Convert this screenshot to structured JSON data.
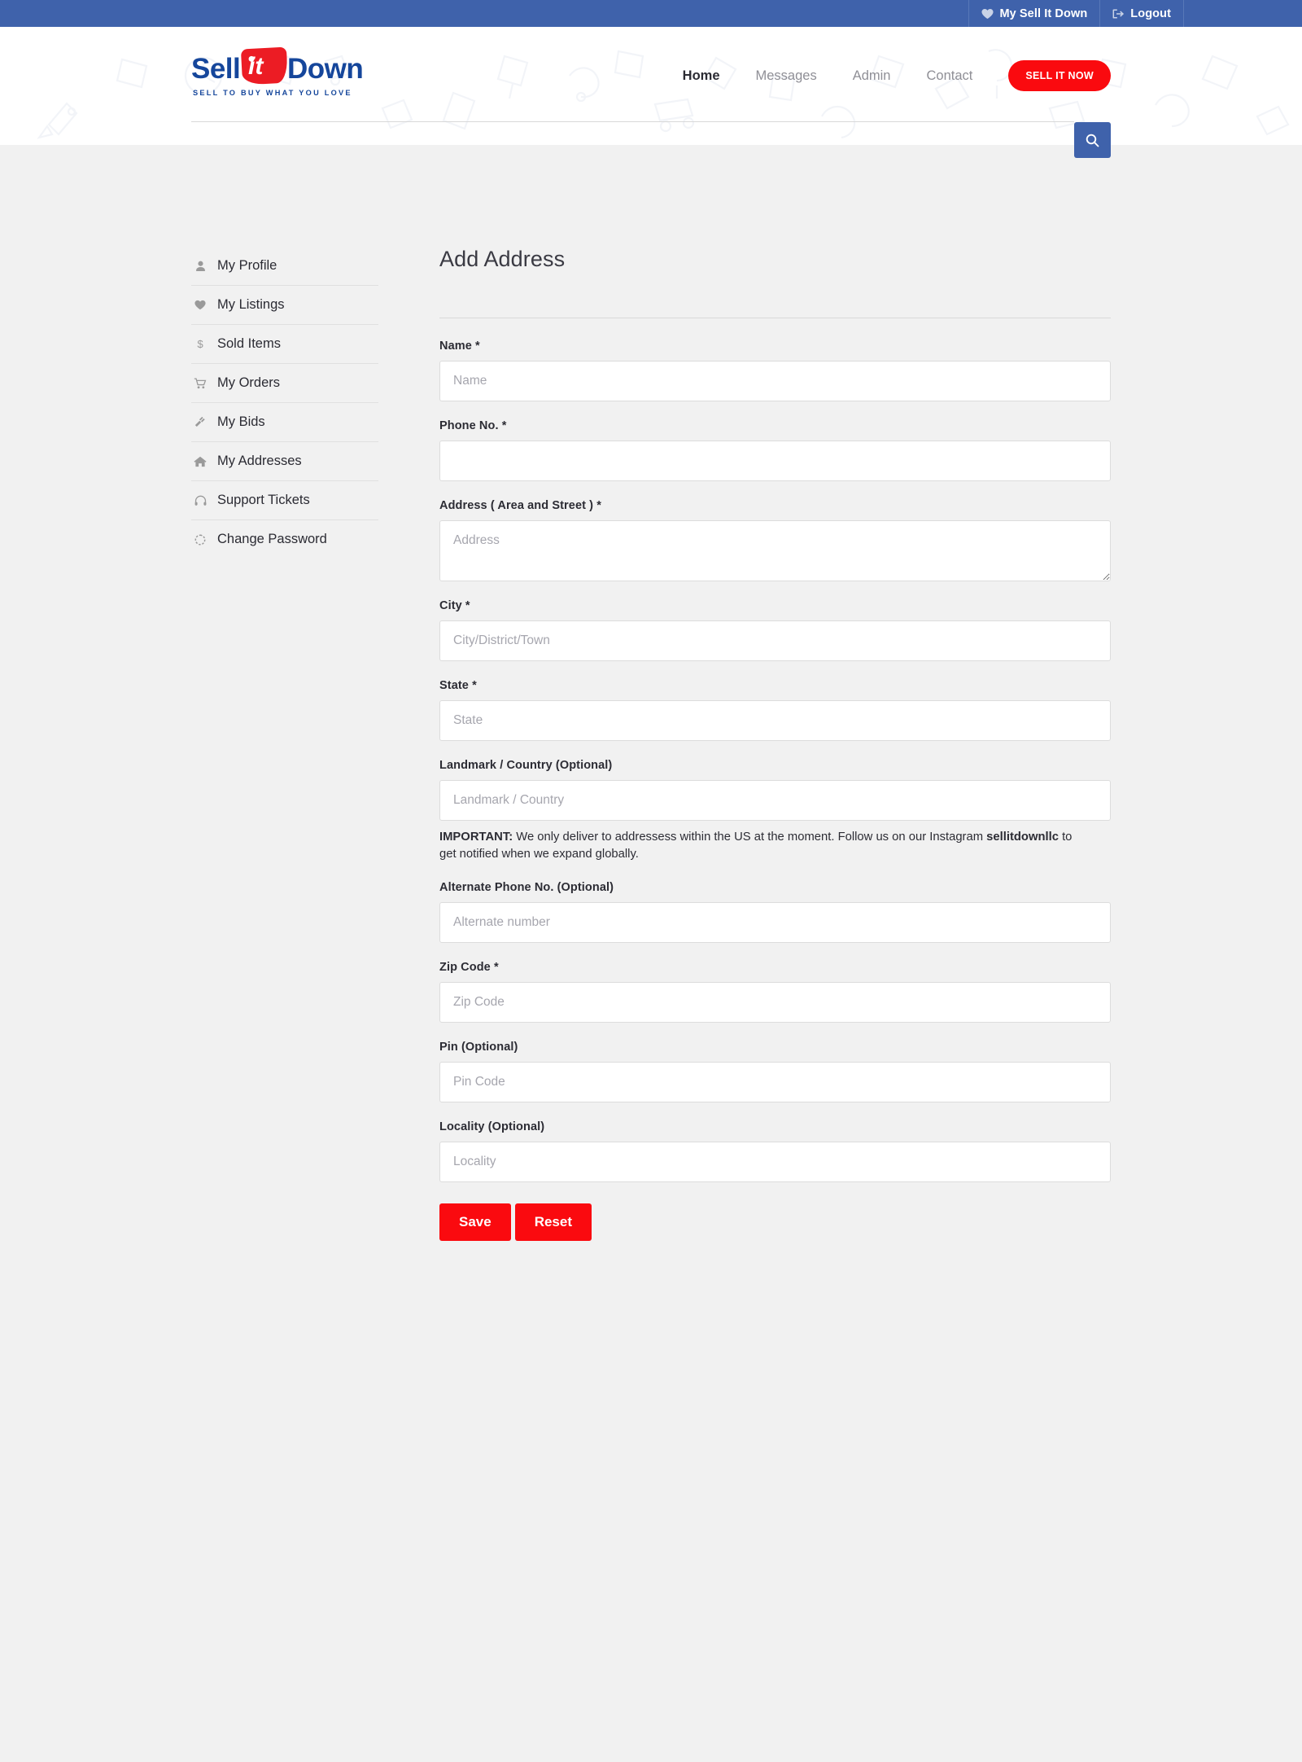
{
  "topbar": {
    "items": [
      {
        "label": "My Sell It Down",
        "icon": "heart-icon"
      },
      {
        "label": "Logout",
        "icon": "logout-icon"
      }
    ]
  },
  "brand": {
    "word1": "Sell",
    "badge": "it",
    "word2": "Down",
    "tagline": "SELL TO BUY WHAT YOU LOVE"
  },
  "nav": {
    "links": [
      {
        "label": "Home",
        "active": true
      },
      {
        "label": "Messages",
        "active": false
      },
      {
        "label": "Admin",
        "active": false
      },
      {
        "label": "Contact",
        "active": false
      }
    ],
    "cta": "SELL IT NOW"
  },
  "search": {
    "value": "",
    "placeholder": "",
    "icon": "search-icon"
  },
  "sidebar": {
    "items": [
      {
        "label": "My Profile",
        "icon": "user-icon"
      },
      {
        "label": "My Listings",
        "icon": "heart-icon"
      },
      {
        "label": "Sold Items",
        "icon": "dollar-icon"
      },
      {
        "label": "My Orders",
        "icon": "cart-icon"
      },
      {
        "label": "My Bids",
        "icon": "gavel-icon"
      },
      {
        "label": "My Addresses",
        "icon": "home-icon"
      },
      {
        "label": "Support Tickets",
        "icon": "headset-icon"
      },
      {
        "label": "Change Password",
        "icon": "refresh-icon"
      }
    ]
  },
  "form": {
    "title": "Add Address",
    "fields": [
      {
        "label": "Name *",
        "placeholder": "Name",
        "value": "",
        "type": "text"
      },
      {
        "label": "Phone No. *",
        "placeholder": "",
        "value": "",
        "type": "text"
      },
      {
        "label": "Address ( Area and Street ) *",
        "placeholder": "Address",
        "value": "",
        "type": "textarea"
      },
      {
        "label": "City *",
        "placeholder": "City/District/Town",
        "value": "",
        "type": "text"
      },
      {
        "label": "State *",
        "placeholder": "State",
        "value": "",
        "type": "text"
      },
      {
        "label": "Landmark / Country (Optional)",
        "placeholder": "Landmark / Country",
        "value": "",
        "type": "text"
      },
      {
        "label": "Alternate Phone No. (Optional)",
        "placeholder": "Alternate number",
        "value": "",
        "type": "text"
      },
      {
        "label": "Zip Code *",
        "placeholder": "Zip Code",
        "value": "",
        "type": "text"
      },
      {
        "label": "Pin (Optional)",
        "placeholder": "Pin Code",
        "value": "",
        "type": "text"
      },
      {
        "label": "Locality (Optional)",
        "placeholder": "Locality",
        "value": "",
        "type": "text"
      }
    ],
    "note": {
      "lead": "IMPORTANT:",
      "text_before": " We only deliver to addressess within the US at the moment. Follow us on our Instagram ",
      "handle": "sellitdownllc",
      "text_after": " to get notified when we expand globally."
    },
    "save_label": "Save",
    "reset_label": "Reset"
  },
  "colors": {
    "topbar_blue": "#3f62ab",
    "brand_blue": "#15469b",
    "brand_red": "#ec1c24",
    "button_red": "#fa0a0f",
    "body_grey": "#f1f1f1"
  }
}
